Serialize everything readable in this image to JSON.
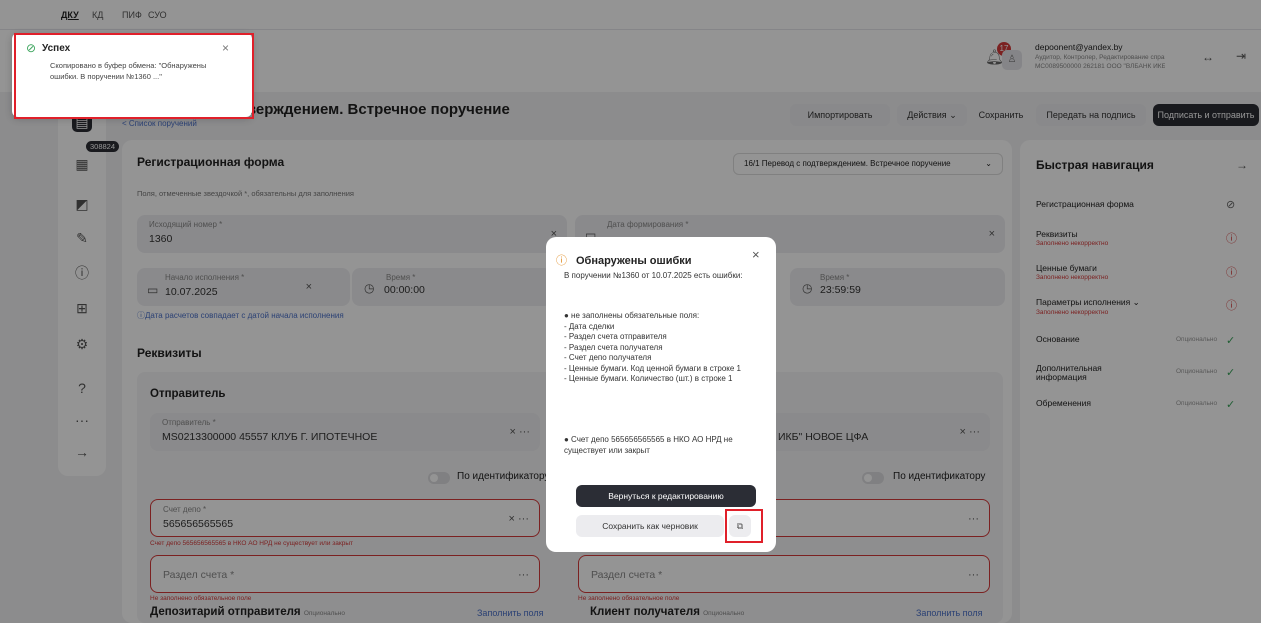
{
  "top_tabs": [
    "ДКУ",
    "КД",
    "ПИФ",
    "СУО"
  ],
  "header": {
    "notif_count": "17",
    "user_email": "depoonent@yandex.by",
    "user_role": "Аудитор, Контролер, Редактирование справ...",
    "user_org": "MC0089500000 262181 ООО \"ВЛБАНК ИКБ\" ...",
    "page_title": "дтверждением. Встречное поручение",
    "breadcrumb": "< Список поручений",
    "actions": {
      "import": "Импортировать",
      "actions": "Действия",
      "save": "Сохранить",
      "to_sign": "Передать на подпись",
      "sign_send": "Подписать и отправить"
    }
  },
  "sidebar": {
    "badge": "308824"
  },
  "reg_form": {
    "title": "Регистрационная форма",
    "type_select": "16/1 Перевод с подтверждением. Встречное поручение",
    "required_note": "Поля, отмеченные звездочкой *, обязательны для заполнения",
    "out_number_label": "Исходящий номер *",
    "out_number": "1360",
    "date_formed_label": "Дата формирования *",
    "start_label": "Начало исполнения *",
    "start_date": "10.07.2025",
    "time_label": "Время *",
    "time_start": "00:00:00",
    "time_end_label": "Время *",
    "time_end": "23:59:59",
    "calc_note": "Дата расчетов совпадает с датой начала исполнения"
  },
  "requisites": {
    "title": "Реквизиты",
    "sender_title": "Отправитель",
    "sender_label": "Отправитель *",
    "sender_value": "MS0213300000 45557 КЛУБ Г. ИПОТЕЧНОЕ",
    "receiver_value": "ИКБ\" НОВОЕ ЦФА",
    "by_id": "По идентификатору",
    "depo_label": "Счет депо *",
    "depo_value": "565656565565",
    "depo_error": "Счет депо 565656565565 в НКО АО НРД не существует или закрыт",
    "section_label": "Раздел счета *",
    "section_error": "Не заполнено обязательное поле",
    "depositary_title": "Депозитарий отправителя",
    "client_title": "Клиент получателя",
    "optional": "Опционально",
    "fill_fields": "Заполнить поля"
  },
  "quick_nav": {
    "title": "Быстрая навигация",
    "items": [
      {
        "label": "Регистрационная форма",
        "sub": "",
        "status": "ok"
      },
      {
        "label": "Реквизиты",
        "sub": "Заполнено некорректно",
        "status": "error"
      },
      {
        "label": "Ценные бумаги",
        "sub": "Заполнено некорректно",
        "status": "error"
      },
      {
        "label": "Параметры исполнения",
        "sub": "Заполнено некорректно",
        "status": "error"
      },
      {
        "label": "Основание",
        "sub": "Опционально",
        "status": "ok"
      },
      {
        "label": "Дополнительная информация",
        "sub": "Опционально",
        "status": "ok"
      },
      {
        "label": "Обременения",
        "sub": "Опционально",
        "status": "ok"
      }
    ]
  },
  "toast": {
    "title": "Успех",
    "text": "Скопировано в буфер обмена: \"Обнаружены ошибки. В поручении №1360 ...\""
  },
  "modal": {
    "title": "Обнаружены ошибки",
    "intro": "В поручении №1360 от 10.07.2025 есть ошибки:",
    "missing_header": "● не заполнены обязательные поля:",
    "missing": [
      "- Дата сделки",
      "- Раздел счета отправителя",
      "- Раздел счета получателя",
      "- Счет депо получателя",
      "- Ценные бумаги. Код ценной бумаги  в строке 1",
      "- Ценные бумаги. Количество (шт.)  в строке 1"
    ],
    "depo_error": "● Счет депо 565656565565 в НКО АО НРД не существует или закрыт",
    "back_btn": "Вернуться к редактированию",
    "draft_btn": "Сохранить как черновик"
  }
}
